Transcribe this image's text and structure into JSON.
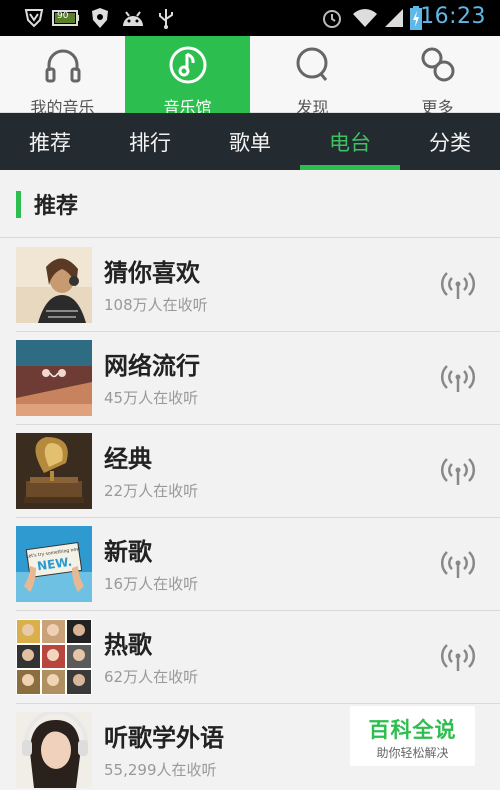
{
  "status_bar": {
    "time": "16:23",
    "battery_level": "90",
    "icons": [
      "shield-v-icon",
      "battery-icon",
      "security-shield-icon",
      "android-icon",
      "usb-icon",
      "alarm-clock-icon",
      "wifi-icon",
      "signal-icon",
      "charging-battery-icon"
    ]
  },
  "top_nav": {
    "tabs": [
      {
        "label": "我的音乐",
        "icon": "headphones-icon",
        "active": false
      },
      {
        "label": "音乐馆",
        "icon": "music-note-icon",
        "active": true
      },
      {
        "label": "发现",
        "icon": "search-discover-icon",
        "active": false
      },
      {
        "label": "更多",
        "icon": "more-circles-icon",
        "active": false
      }
    ]
  },
  "category_bar": {
    "items": [
      {
        "label": "推荐",
        "active": false
      },
      {
        "label": "排行",
        "active": false
      },
      {
        "label": "歌单",
        "active": false
      },
      {
        "label": "电台",
        "active": true
      },
      {
        "label": "分类",
        "active": false
      }
    ]
  },
  "section": {
    "title": "推荐"
  },
  "stations": [
    {
      "name": "猜你喜欢",
      "listeners": "108万人在收听"
    },
    {
      "name": "网络流行",
      "listeners": "45万人在收听"
    },
    {
      "name": "经典",
      "listeners": "22万人在收听"
    },
    {
      "name": "新歌",
      "listeners": "16万人在收听"
    },
    {
      "name": "热歌",
      "listeners": "62万人在收听"
    },
    {
      "name": "听歌学外语",
      "listeners": "55,299人在收听"
    }
  ],
  "thumb_text": {
    "new_sign": "NEW.",
    "sign_small": "Let's try something new"
  },
  "watermark": {
    "title": "百科全说",
    "subtitle": "助你轻松解决"
  },
  "colors": {
    "accent": "#2cbe4e",
    "category_bg": "#232b30",
    "time_color": "#5fb8e8"
  }
}
